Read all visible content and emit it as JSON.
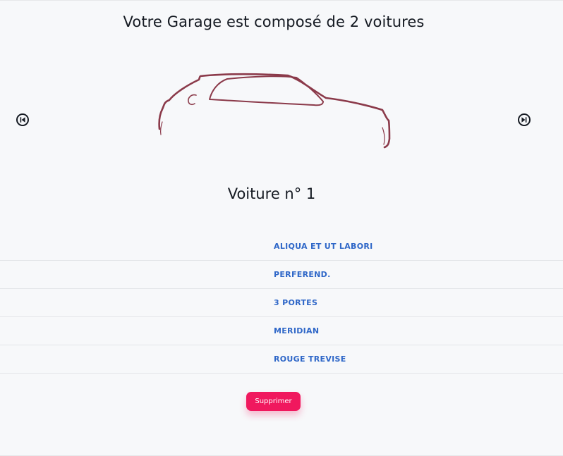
{
  "header": {
    "title": "Votre Garage est composé de 2 voitures"
  },
  "carousel": {
    "prev_icon": "skip-previous-icon",
    "next_icon": "skip-next-icon",
    "car_image": "car-outline-image",
    "car_color": "#8b3a4a",
    "car_name": "Voiture n° 1"
  },
  "specs": [
    {
      "value": "ALIQUA ET UT LABORI"
    },
    {
      "value": "PERFEREND."
    },
    {
      "value": "3 PORTES"
    },
    {
      "value": "MERIDIAN"
    },
    {
      "value": "ROUGE TREVISE"
    }
  ],
  "actions": {
    "delete_label": "Supprimer",
    "delete_color": "#f0185e"
  },
  "colors": {
    "spec_text": "#2f67c8",
    "background": "#f7f8fa"
  }
}
